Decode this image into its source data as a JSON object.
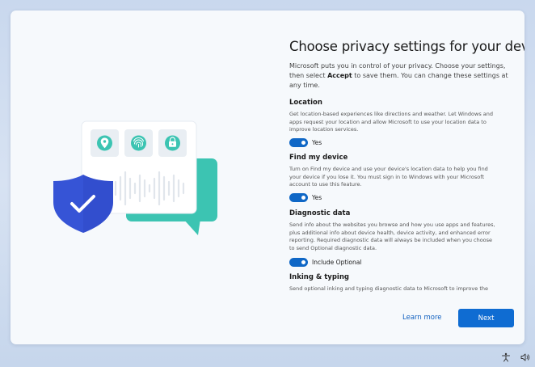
{
  "title": "Choose privacy settings for your device",
  "subtitle_pre": "Microsoft puts you in control of your privacy. Choose your settings, then select ",
  "subtitle_bold": "Accept",
  "subtitle_post": " to save them. You can change these settings at any time.",
  "sections": [
    {
      "title": "Location",
      "desc": "Get location-based experiences like directions and weather. Let Windows and apps request your location and allow Microsoft to use your location data to improve location services.",
      "toggle_label": "Yes",
      "toggle_on": true
    },
    {
      "title": "Find my device",
      "desc": "Turn on Find my device and use your device's location data to help you find your device if you lose it. You must sign in to Windows with your Microsoft account to use this feature.",
      "toggle_label": "Yes",
      "toggle_on": true
    },
    {
      "title": "Diagnostic data",
      "desc": "Send info about the websites you browse and how you use apps and features, plus additional info about device health, device activity, and enhanced error reporting. Required diagnostic data will always be included when you choose to send Optional diagnostic data.",
      "toggle_label": "Include Optional",
      "toggle_on": true
    },
    {
      "title": "Inking & typing",
      "desc": "Send optional inking and typing diagnostic data to Microsoft to improve the"
    }
  ],
  "footer": {
    "learn_more": "Learn more",
    "next": "Next"
  },
  "colors": {
    "accent": "#0f6cd2",
    "shield": "#3654d6",
    "teal": "#3cc4b2"
  },
  "icons": [
    "location-pin-icon",
    "fingerprint-icon",
    "padlock-icon",
    "shield-check-icon",
    "accessibility-icon",
    "volume-icon"
  ]
}
